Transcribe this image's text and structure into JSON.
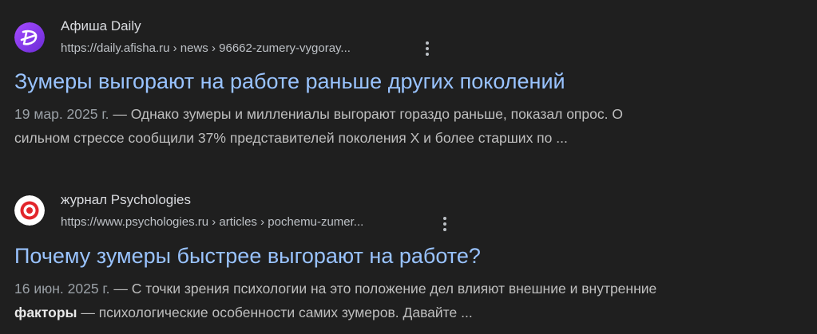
{
  "colors": {
    "background": "#1f1f1f",
    "title_link": "#99c3ff",
    "snippet_text": "#bfbfbf",
    "date_text": "#9aa0a6"
  },
  "results": [
    {
      "site_name": "Афиша Daily",
      "favicon_icon": "afisha-daily-logo-icon",
      "url": "https://daily.afisha.ru › news › 96662-zumery-vygoray...",
      "title": "Зумеры выгорают на работе раньше других поколений",
      "date": "19 мар. 2025 г.",
      "dash": " — ",
      "snippet_line1": "Однако зумеры и миллениалы выгорают гораздо раньше, показал опрос. О",
      "snippet_line2": "сильном стрессе сообщили 37% представителей поколения X и более старших по ..."
    },
    {
      "site_name": "журнал Psychologies",
      "favicon_icon": "psychologies-logo-icon",
      "url": "https://www.psychologies.ru › articles › pochemu-zumer...",
      "title": "Почему зумеры быстрее выгорают на работе?",
      "date": "16 июн. 2025 г.",
      "dash": " — ",
      "snippet_line1": "С точки зрения психологии на это положение дел влияют внешние и внутренние",
      "snippet_bold": "факторы",
      "snippet_line2": " — психологические особенности самих зумеров. Давайте ..."
    }
  ]
}
